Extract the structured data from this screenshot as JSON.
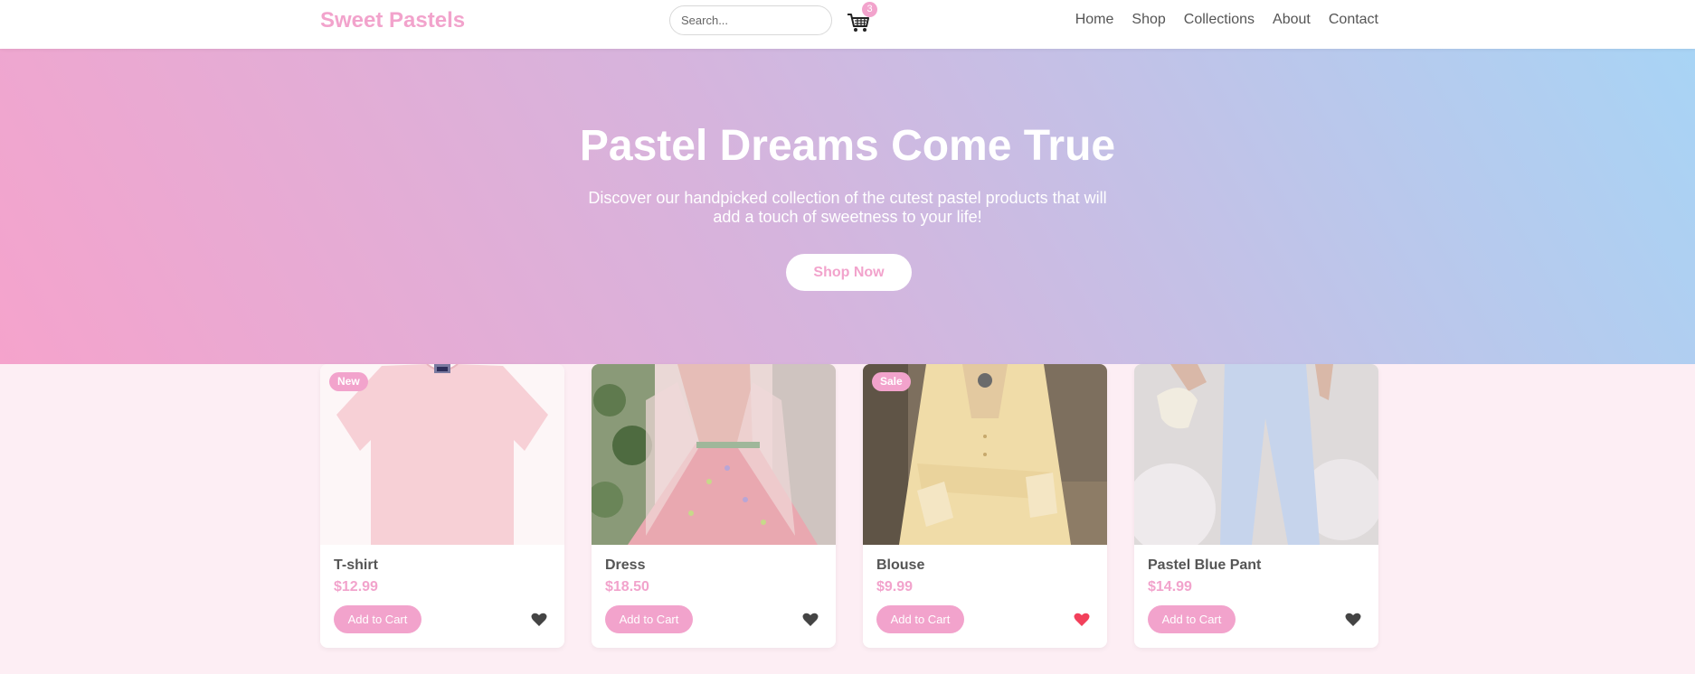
{
  "header": {
    "logo": "Sweet Pastels",
    "search_placeholder": "Search...",
    "cart_count": "3",
    "nav": [
      "Home",
      "Shop",
      "Collections",
      "About",
      "Contact"
    ]
  },
  "hero": {
    "title": "Pastel Dreams Come True",
    "subtitle": "Discover our handpicked collection of the cutest pastel products that will add a touch of sweetness to your life!",
    "cta": "Shop Now"
  },
  "products": [
    {
      "name": "T-shirt",
      "price": "$12.99",
      "badge": "New",
      "button": "Add to Cart",
      "liked": false
    },
    {
      "name": "Dress",
      "price": "$18.50",
      "badge": "",
      "button": "Add to Cart",
      "liked": false
    },
    {
      "name": "Blouse",
      "price": "$9.99",
      "badge": "Sale",
      "button": "Add to Cart",
      "liked": true
    },
    {
      "name": "Pastel Blue Pant",
      "price": "$14.99",
      "badge": "",
      "button": "Add to Cart",
      "liked": false
    }
  ],
  "colors": {
    "accent": "#f2a3cc",
    "text": "#555555",
    "heart_liked": "#f2405b",
    "heart_default": "#444444",
    "page_bg": "#fdeef4"
  },
  "icons": {
    "cart": "shopping-cart-icon",
    "heart": "heart-icon"
  }
}
